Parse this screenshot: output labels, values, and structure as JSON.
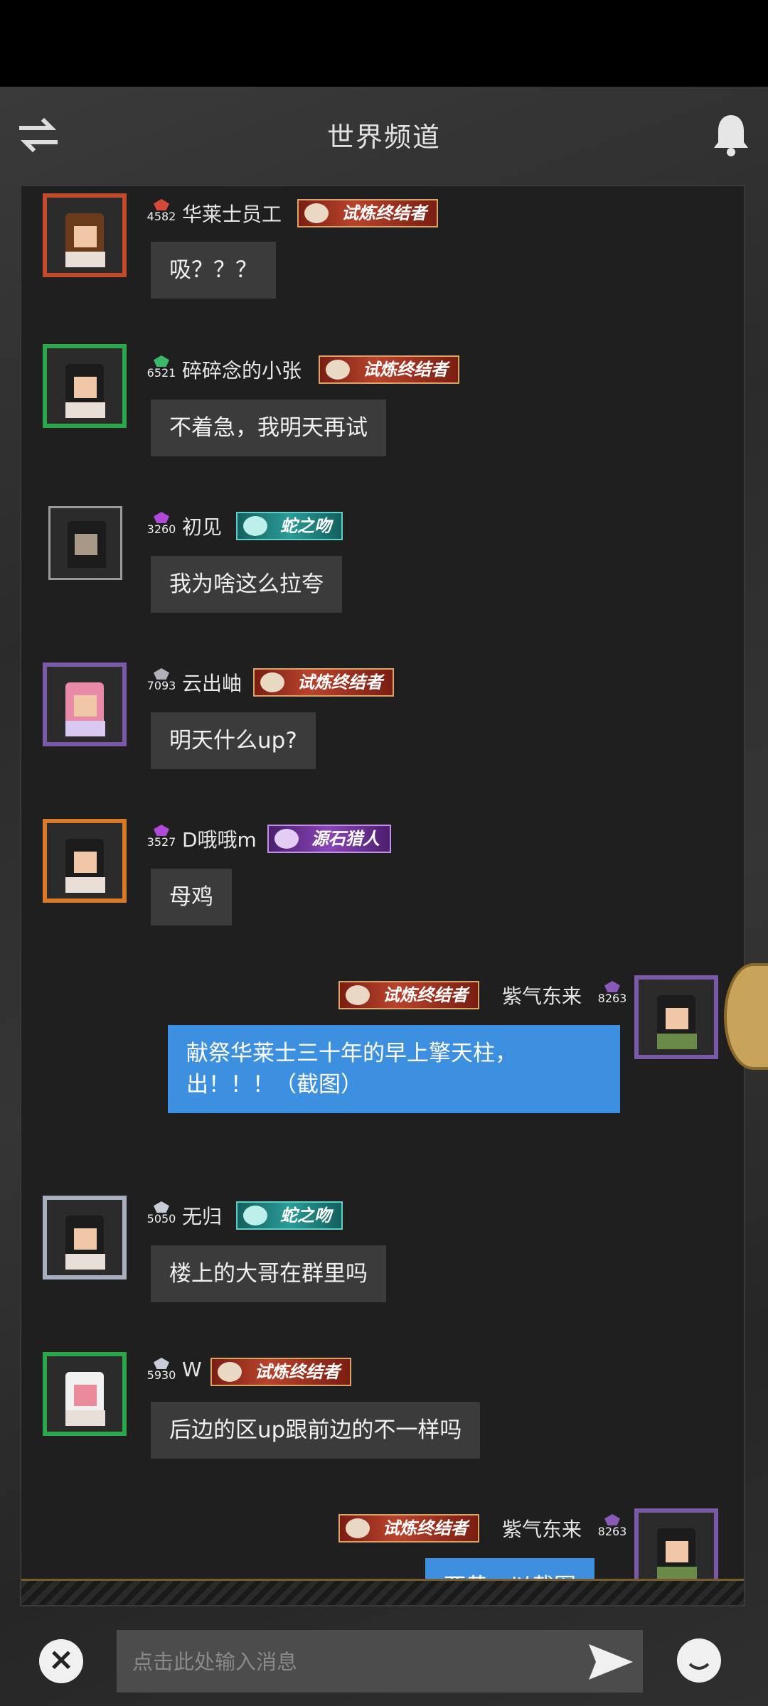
{
  "header": {
    "title": "世界频道"
  },
  "colors": {
    "my_bubble": "#3d8fe0",
    "other_bubble": "#3b3b3b",
    "panel": "#1f1f1f"
  },
  "messages": [
    {
      "user": "华莱士员工",
      "level": "4582",
      "title": "试炼终结者",
      "text": "吸？？？",
      "side": "left"
    },
    {
      "user": "碎碎念的小张",
      "level": "6521",
      "title": "试炼终结者",
      "text": "不着急，我明天再试",
      "side": "left"
    },
    {
      "user": "初见",
      "level": "3260",
      "title": "蛇之吻",
      "text": "我为啥这么拉夸",
      "side": "left"
    },
    {
      "user": "云出岫",
      "level": "7093",
      "title": "试炼终结者",
      "text": "明天什么up?",
      "side": "left"
    },
    {
      "user": "D哦哦m",
      "level": "3527",
      "title": "源石猎人",
      "text": "母鸡",
      "side": "left"
    },
    {
      "user": "紫气东来",
      "level": "8263",
      "title": "试炼终结者",
      "text": "献祭华莱士三十年的早上擎天柱，出！！！（截图）",
      "side": "right"
    },
    {
      "user": "无归",
      "level": "5050",
      "title": "蛇之吻",
      "text": "楼上的大哥在群里吗",
      "side": "left"
    },
    {
      "user": "W",
      "level": "5930",
      "title": "试炼终结者",
      "text": "后边的区up跟前边的不一样吗",
      "side": "left"
    },
    {
      "user": "紫气东来",
      "level": "8263",
      "title": "试炼终结者",
      "text": "两黄，以截图",
      "side": "right"
    }
  ],
  "input": {
    "placeholder": "点击此处输入消息"
  },
  "icons": {
    "header_left": "swap-arrows-icon",
    "header_right": "bell-icon",
    "input_left": "close-icon",
    "send": "send-icon",
    "emoji": "emoji-icon"
  }
}
